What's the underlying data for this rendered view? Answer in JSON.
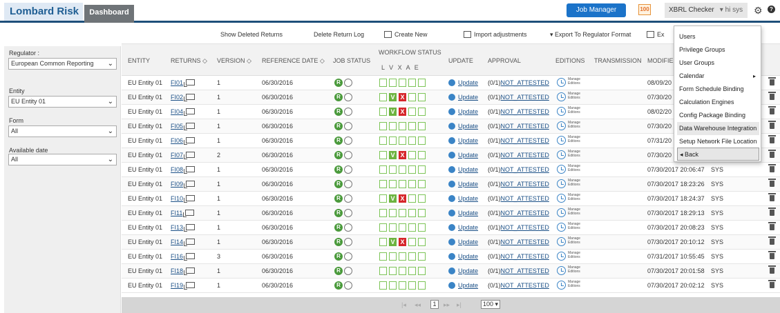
{
  "header": {
    "logo": "Lombard Risk",
    "tab_dashboard": "Dashboard",
    "job_manager": "Job Manager",
    "badge_count": "100",
    "xbrl_checker": "XBRL Checker",
    "user": "▾ hi sys",
    "gear_icon": "gear-icon",
    "help_icon": "help-icon",
    "help_glyph": "?"
  },
  "toolbar": {
    "show_deleted": "Show Deleted Returns",
    "delete_log": "Delete Return Log",
    "create_new": "Create New",
    "import_adjustments": "Import adjustments",
    "export_regulator": "▾ Export To Regulator Format",
    "export_short": "Ex"
  },
  "sidebar": {
    "regulator_label": "Regulator :",
    "regulator_value": "European Common Reporting",
    "entity_label": "Entity",
    "entity_value": "EU Entity 01",
    "form_label": "Form",
    "form_value": "All",
    "date_label": "Available date",
    "date_value": "All"
  },
  "columns": {
    "entity": "ENTITY",
    "returns": "RETURNS ◇",
    "version": "VERSION ◇",
    "reference_date": "REFERENCE DATE ◇",
    "job_status": "JOB STATUS",
    "workflow_status": "WORKFLOW STATUS",
    "workflow_letters": "L V X A E",
    "update": "UPDATE",
    "approval": "APPROVAL",
    "editions": "EDITIONS",
    "transmission": "TRANSMISSION",
    "modified": "MODIFIE"
  },
  "rows": [
    {
      "entity": "EU Entity 01",
      "return": "FI01",
      "version": "1",
      "ref_date": "06/30/2016",
      "workflow": [
        "e",
        "e",
        "e",
        "e",
        "e"
      ],
      "update": "Update",
      "approval_prefix": "(0/1)",
      "approval": "NOT_ATTESTED",
      "modified": "08/09/20",
      "user": ""
    },
    {
      "entity": "EU Entity 01",
      "return": "FI02",
      "version": "1",
      "ref_date": "06/30/2016",
      "workflow": [
        "e",
        "v",
        "x",
        "e",
        "e"
      ],
      "update": "Update",
      "approval_prefix": "(0/1)",
      "approval": "NOT_ATTESTED",
      "modified": "07/30/20",
      "user": ""
    },
    {
      "entity": "EU Entity 01",
      "return": "FI04",
      "version": "1",
      "ref_date": "06/30/2016",
      "workflow": [
        "e",
        "v",
        "x",
        "e",
        "e"
      ],
      "update": "Update",
      "approval_prefix": "(0/1)",
      "approval": "NOT_ATTESTED",
      "modified": "08/02/20",
      "user": ""
    },
    {
      "entity": "EU Entity 01",
      "return": "FI05",
      "version": "1",
      "ref_date": "06/30/2016",
      "workflow": [
        "e",
        "e",
        "e",
        "e",
        "e"
      ],
      "update": "Update",
      "approval_prefix": "(0/1)",
      "approval": "NOT_ATTESTED",
      "modified": "07/30/20",
      "user": ""
    },
    {
      "entity": "EU Entity 01",
      "return": "FI06",
      "version": "1",
      "ref_date": "06/30/2016",
      "workflow": [
        "e",
        "e",
        "e",
        "e",
        "e"
      ],
      "update": "Update",
      "approval_prefix": "(0/1)",
      "approval": "NOT_ATTESTED",
      "modified": "07/31/20",
      "user": ""
    },
    {
      "entity": "EU Entity 01",
      "return": "FI07",
      "version": "2",
      "ref_date": "06/30/2016",
      "workflow": [
        "e",
        "v",
        "x",
        "e",
        "e"
      ],
      "update": "Update",
      "approval_prefix": "(0/1)",
      "approval": "NOT_ATTESTED",
      "modified": "07/30/20",
      "user": ""
    },
    {
      "entity": "EU Entity 01",
      "return": "FI08",
      "version": "1",
      "ref_date": "06/30/2016",
      "workflow": [
        "e",
        "e",
        "e",
        "e",
        "e"
      ],
      "update": "Update",
      "approval_prefix": "(0/1)",
      "approval": "NOT_ATTESTED",
      "modified": "07/30/2017 20:06:47",
      "user": "SYS"
    },
    {
      "entity": "EU Entity 01",
      "return": "FI09",
      "version": "1",
      "ref_date": "06/30/2016",
      "workflow": [
        "e",
        "e",
        "e",
        "e",
        "e"
      ],
      "update": "Update",
      "approval_prefix": "(0/1)",
      "approval": "NOT_ATTESTED",
      "modified": "07/30/2017 18:23:26",
      "user": "SYS"
    },
    {
      "entity": "EU Entity 01",
      "return": "FI10",
      "version": "1",
      "ref_date": "06/30/2016",
      "workflow": [
        "e",
        "v",
        "x",
        "e",
        "e"
      ],
      "update": "Update",
      "approval_prefix": "(0/1)",
      "approval": "NOT_ATTESTED",
      "modified": "07/30/2017 18:24:37",
      "user": "SYS"
    },
    {
      "entity": "EU Entity 01",
      "return": "FI11",
      "version": "1",
      "ref_date": "06/30/2016",
      "workflow": [
        "e",
        "e",
        "e",
        "e",
        "e"
      ],
      "update": "Update",
      "approval_prefix": "(0/1)",
      "approval": "NOT_ATTESTED",
      "modified": "07/30/2017 18:29:13",
      "user": "SYS"
    },
    {
      "entity": "EU Entity 01",
      "return": "FI13",
      "version": "1",
      "ref_date": "06/30/2016",
      "workflow": [
        "e",
        "e",
        "e",
        "e",
        "e"
      ],
      "update": "Update",
      "approval_prefix": "(0/1)",
      "approval": "NOT_ATTESTED",
      "modified": "07/30/2017 20:08:23",
      "user": "SYS"
    },
    {
      "entity": "EU Entity 01",
      "return": "FI14",
      "version": "1",
      "ref_date": "06/30/2016",
      "workflow": [
        "e",
        "v",
        "x",
        "e",
        "e"
      ],
      "update": "Update",
      "approval_prefix": "(0/1)",
      "approval": "NOT_ATTESTED",
      "modified": "07/30/2017 20:10:12",
      "user": "SYS"
    },
    {
      "entity": "EU Entity 01",
      "return": "FI16",
      "version": "3",
      "ref_date": "06/30/2016",
      "workflow": [
        "e",
        "e",
        "e",
        "e",
        "e"
      ],
      "update": "Update",
      "approval_prefix": "(0/1)",
      "approval": "NOT_ATTESTED",
      "modified": "07/31/2017 10:55:45",
      "user": "SYS"
    },
    {
      "entity": "EU Entity 01",
      "return": "FI18",
      "version": "1",
      "ref_date": "06/30/2016",
      "workflow": [
        "e",
        "e",
        "e",
        "e",
        "e"
      ],
      "update": "Update",
      "approval_prefix": "(0/1)",
      "approval": "NOT_ATTESTED",
      "modified": "07/30/2017 20:01:58",
      "user": "SYS"
    },
    {
      "entity": "EU Entity 01",
      "return": "FI19",
      "version": "1",
      "ref_date": "06/30/2016",
      "workflow": [
        "e",
        "e",
        "e",
        "e",
        "e"
      ],
      "update": "Update",
      "approval_prefix": "(0/1)",
      "approval": "NOT_ATTESTED",
      "modified": "07/30/2017 20:02:12",
      "user": "SYS"
    }
  ],
  "row_labels": {
    "job_r": "R",
    "manage_line1": "Manage",
    "manage_line2": "Editions",
    "wf_v": "V",
    "wf_x": "X"
  },
  "pager": {
    "first": "|◂",
    "prev": "◂◂",
    "page": "1",
    "next": "▸▸",
    "last": "▸|",
    "page_size": "100 ▾"
  },
  "menu": {
    "items": [
      {
        "label": "Users",
        "submenu": false
      },
      {
        "label": "Privilege Groups",
        "submenu": false
      },
      {
        "label": "User Groups",
        "submenu": false
      },
      {
        "label": "Calendar",
        "submenu": true
      },
      {
        "label": "Form Schedule Binding",
        "submenu": false
      },
      {
        "label": "Calculation Engines",
        "submenu": false
      },
      {
        "label": "Config Package Binding",
        "submenu": false
      },
      {
        "label": "Data Warehouse Integration",
        "submenu": false,
        "active": true
      },
      {
        "label": "Setup Network File Location",
        "submenu": false
      }
    ],
    "back": "◂ Back",
    "submenu_arrow": "▸"
  },
  "colors": {
    "header_border": "#1e4f7a",
    "accent_blue": "#1b73c9",
    "workflow_green": "#6cb33f",
    "workflow_red": "#d6262a"
  }
}
